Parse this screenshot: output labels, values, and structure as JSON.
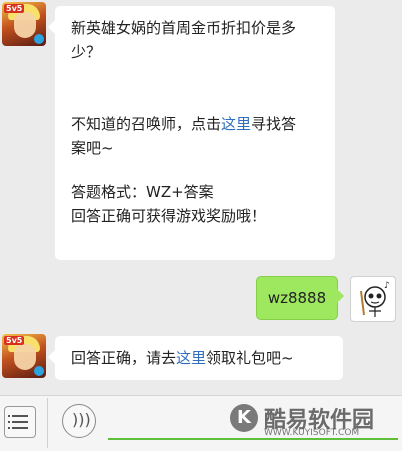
{
  "messages": [
    {
      "sender": "game-account",
      "lines": {
        "q1": "新英雄女娲的首周金币折扣价是多",
        "q2": "少？",
        "p1": "不知道的召唤师，点击",
        "link": "这里",
        "p1b": "寻找答",
        "p2": "案吧~",
        "f1": "答题格式：WZ+答案",
        "f2": "回答正确可获得游戏奖励哦！"
      }
    },
    {
      "sender": "user",
      "text": "wz8888"
    },
    {
      "sender": "game-account",
      "lines": {
        "a1": "回答正确，请去",
        "link": "这里",
        "a2": "领取礼包吧~"
      }
    }
  ],
  "avatar_tag": "5v5",
  "watermark": {
    "letter": "K",
    "brand": "酷易软件园",
    "url": "WWW.KUYISOFT.COM"
  },
  "colors": {
    "background": "#ebebeb",
    "user_bubble": "#9ee860",
    "link": "#2f6fbf",
    "input_underline": "#5fbf3a"
  },
  "icons": {
    "menu": "list-menu-icon",
    "voice": "voice-wave-icon"
  }
}
